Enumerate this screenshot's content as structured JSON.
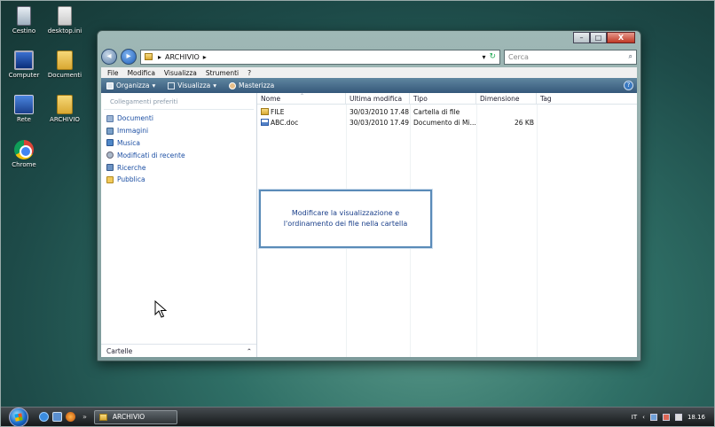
{
  "desktop": {
    "icons": [
      {
        "label": "Cestino"
      },
      {
        "label": "desktop.ini"
      },
      {
        "label": "Computer"
      },
      {
        "label": "Documenti"
      },
      {
        "label": "Rete"
      },
      {
        "label": "ARCHIVIO"
      },
      {
        "label": "Chrome"
      }
    ]
  },
  "window": {
    "caption_buttons": {
      "min": "–",
      "max": "□",
      "close": "X"
    },
    "address": {
      "path": "ARCHIVIO",
      "separator": "▸"
    },
    "search": {
      "placeholder": "Cerca"
    },
    "menu": [
      "File",
      "Modifica",
      "Visualizza",
      "Strumenti",
      "?"
    ],
    "toolbar": {
      "organizza": "Organizza",
      "visualizza": "Visualizza",
      "masterizza": "Masterizza"
    },
    "nav": {
      "header": "Collegamenti preferiti",
      "items": [
        {
          "label": "Documenti",
          "icon": "documents-icon"
        },
        {
          "label": "Immagini",
          "icon": "pictures-icon"
        },
        {
          "label": "Musica",
          "icon": "music-icon"
        },
        {
          "label": "Modificati di recente",
          "icon": "recent-icon"
        },
        {
          "label": "Ricerche",
          "icon": "searches-icon"
        },
        {
          "label": "Pubblica",
          "icon": "public-folder-icon"
        }
      ],
      "folders_label": "Cartelle"
    },
    "columns": [
      "Nome",
      "Ultima modifica",
      "Tipo",
      "Dimensione",
      "Tag"
    ],
    "files": [
      {
        "name": "FILE",
        "modified": "30/03/2010 17.48",
        "type": "Cartella di file",
        "size": "",
        "tag": "",
        "icon": "folder-icon"
      },
      {
        "name": "ABC.doc",
        "modified": "30/03/2010 17.49",
        "type": "Documento di Mi...",
        "size": "26 KB",
        "tag": "",
        "icon": "word-document-icon"
      }
    ]
  },
  "callout": {
    "text": "Modificare la visualizzazione e l'ordinamento dei file nella cartella"
  },
  "taskbar": {
    "task_label": "ARCHIVIO",
    "tray": {
      "lang": "IT",
      "time": "18.16"
    }
  }
}
